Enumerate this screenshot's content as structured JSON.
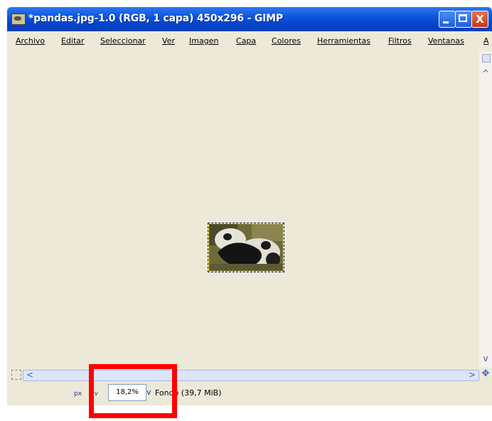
{
  "window": {
    "title": "*pandas.jpg-1.0 (RGB, 1 capa) 450x296 - GIMP",
    "close_glyph": "X"
  },
  "menubar": {
    "items": [
      "Archivo",
      "Editar",
      "Seleccionar",
      "Ver",
      "Imagen",
      "Capa",
      "Colores",
      "Herramientas",
      "Filtros",
      "Ventanas",
      "A"
    ]
  },
  "scrollbars": {
    "up_arrow": "^",
    "down_arrow": "v",
    "left_arrow": "<",
    "right_arrow": ">",
    "nav_glyph": "✥"
  },
  "statusbar": {
    "unit": "px",
    "unit_chevron": "v",
    "zoom_value": "18,2%",
    "zoom_chevron": "v",
    "status_text": "Fondo (39,7 MiB)"
  },
  "colors": {
    "titlebar": "#0b55e0",
    "window_bg": "#ece9d8",
    "highlight": "#ff0000"
  },
  "icons": [
    "gimp-app-icon",
    "minimize-icon",
    "maximize-icon",
    "close-icon",
    "scroll-up-icon",
    "scroll-down-icon",
    "scroll-left-icon",
    "scroll-right-icon",
    "navigate-icon",
    "quick-mask-icon"
  ]
}
